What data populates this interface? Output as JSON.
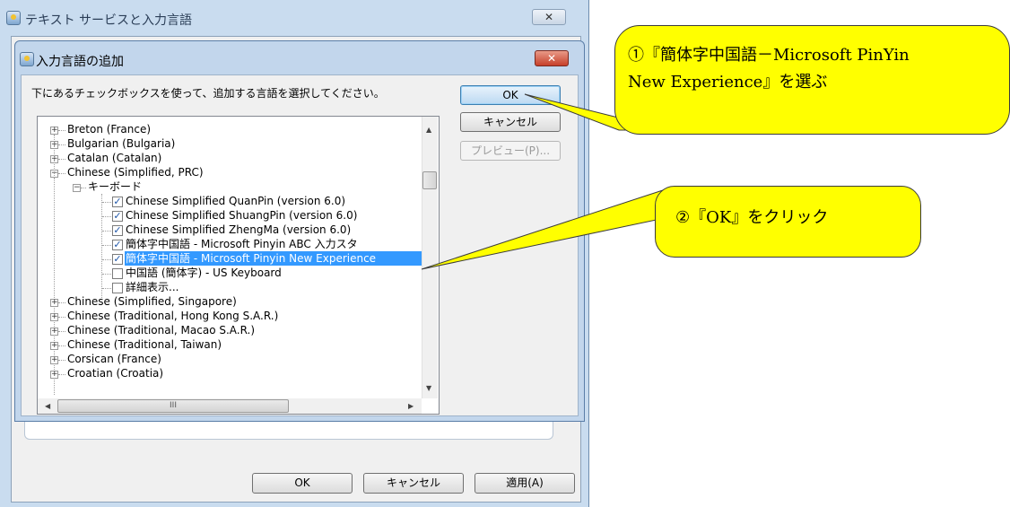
{
  "outer_window": {
    "title": "テキスト サービスと入力言語",
    "close_label": "✕",
    "buttons": {
      "ok": "OK",
      "cancel": "キャンセル",
      "apply": "適用(A)"
    }
  },
  "dialog": {
    "title": "入力言語の追加",
    "close_label": "✕",
    "instruction": "下にあるチェックボックスを使って、追加する言語を選択してください。",
    "buttons": {
      "ok": "OK",
      "cancel": "キャンセル",
      "preview": "プレビュー(P)..."
    }
  },
  "tree": {
    "rows": [
      {
        "label": "Breton (France)",
        "expander": "+"
      },
      {
        "label": "Bulgarian (Bulgaria)",
        "expander": "+"
      },
      {
        "label": "Catalan (Catalan)",
        "expander": "+"
      },
      {
        "label": "Chinese (Simplified, PRC)",
        "expander": "−"
      },
      {
        "label": "キーボード",
        "expander": "−"
      },
      {
        "label": "Chinese Simplified QuanPin (version 6.0)",
        "checked": true
      },
      {
        "label": "Chinese Simplified ShuangPin (version 6.0)",
        "checked": true
      },
      {
        "label": "Chinese Simplified ZhengMa (version 6.0)",
        "checked": true
      },
      {
        "label": "簡体字中国語 - Microsoft Pinyin ABC 入力スタ",
        "checked": true
      },
      {
        "label": "簡体字中国語 - Microsoft Pinyin New Experience",
        "checked": true,
        "selected": true
      },
      {
        "label": "中国語 (簡体字) - US Keyboard",
        "checked": false
      },
      {
        "label": "詳細表示...",
        "checked": false
      },
      {
        "label": "Chinese (Simplified, Singapore)",
        "expander": "+"
      },
      {
        "label": "Chinese (Traditional, Hong Kong S.A.R.)",
        "expander": "+"
      },
      {
        "label": "Chinese (Traditional, Macao S.A.R.)",
        "expander": "+"
      },
      {
        "label": "Chinese (Traditional, Taiwan)",
        "expander": "+"
      },
      {
        "label": "Corsican (France)",
        "expander": "+"
      },
      {
        "label": "Croatian (Croatia)",
        "expander": "+"
      }
    ],
    "hscroll_grip": "III"
  },
  "callouts": {
    "step1_line1": "①『簡体字中国語－Microsoft PinYin",
    "step1_line2": "New Experience』を選ぶ",
    "step2": "②『OK』をクリック"
  },
  "colors": {
    "callout": "#ffff00",
    "selection": "#3399ff"
  }
}
